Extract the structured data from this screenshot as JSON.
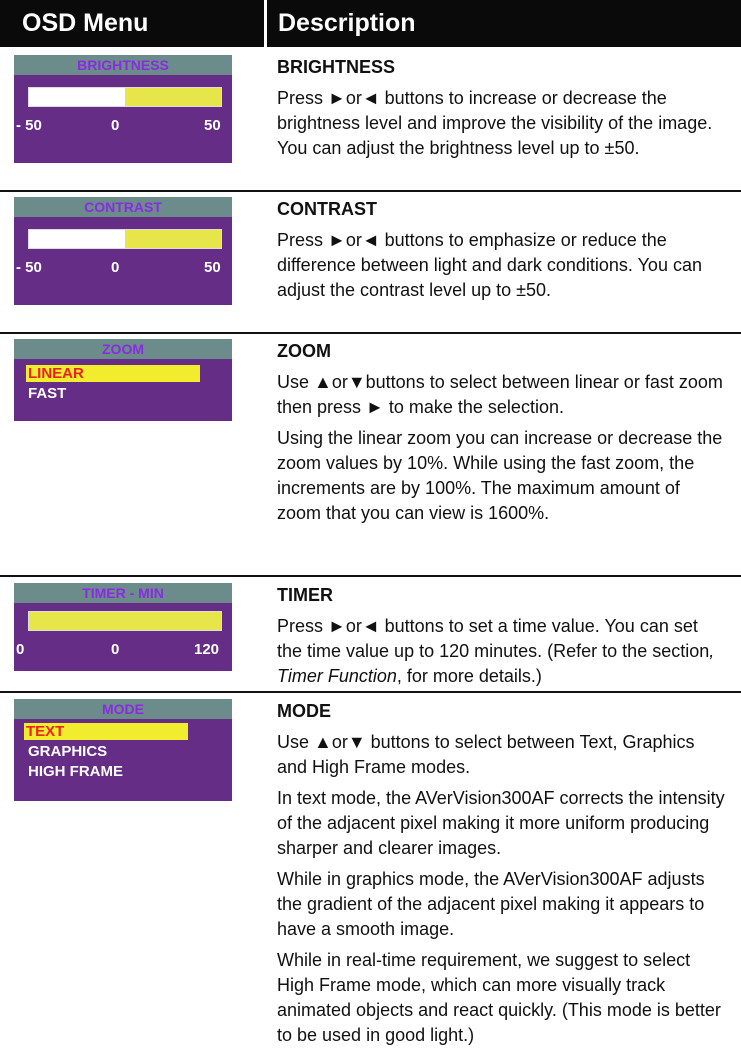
{
  "header": {
    "col1": "OSD Menu",
    "col2": "Description"
  },
  "brightness": {
    "osd_title": "BRIGHTNESS",
    "level": 0,
    "scale": [
      "- 50",
      "0",
      "50"
    ],
    "title": "BRIGHTNESS",
    "text": "Press ►or◄ buttons to increase or decrease the brightness level and improve the visibility of the image. You can adjust the brightness level up to ±50."
  },
  "contrast": {
    "osd_title": "CONTRAST",
    "level": 0,
    "scale": [
      "- 50",
      "0",
      "50"
    ],
    "title": "CONTRAST",
    "text": "Press ►or◄ buttons to emphasize or reduce the difference between light and dark conditions. You can adjust the contrast level up to ±50."
  },
  "zoom": {
    "osd_title": "ZOOM",
    "options": [
      "LINEAR",
      "FAST"
    ],
    "title": "ZOOM",
    "text1": "Use ▲or▼buttons to select between linear or fast zoom then press ► to make the selection.",
    "text2": "Using the linear zoom you can increase or decrease the zoom values by 10%. While using the fast zoom, the increments are by 100%. The maximum amount of zoom that you can view is 1600%."
  },
  "timer": {
    "osd_title": "TIMER - MIN",
    "scale": [
      "0",
      "0",
      "120"
    ],
    "title": "TIMER",
    "text_a": "Press ►or◄ buttons to set a time value. You can set the time value up to 120 minutes. (Refer to the section",
    "text_b": ", ",
    "text_em": "Timer Function",
    "text_c": ", for more details.)"
  },
  "mode": {
    "osd_title": "MODE",
    "options": [
      "TEXT",
      "GRAPHICS",
      "HIGH FRAME"
    ],
    "title": "MODE",
    "text1": "Use ▲or▼ buttons to select between Text, Graphics and High Frame modes.",
    "text2": "In text mode, the AVerVision300AF corrects the intensity of the adjacent pixel making it more uniform producing sharper and clearer images.",
    "text3": "While in graphics mode, the AVerVision300AF adjusts the gradient of the adjacent pixel making it appears to have a smooth image.",
    "text4": "While in real-time requirement, we suggest to select High Frame mode, which can more visually track animated objects and react quickly. (This mode is better to be used in good light.)"
  }
}
